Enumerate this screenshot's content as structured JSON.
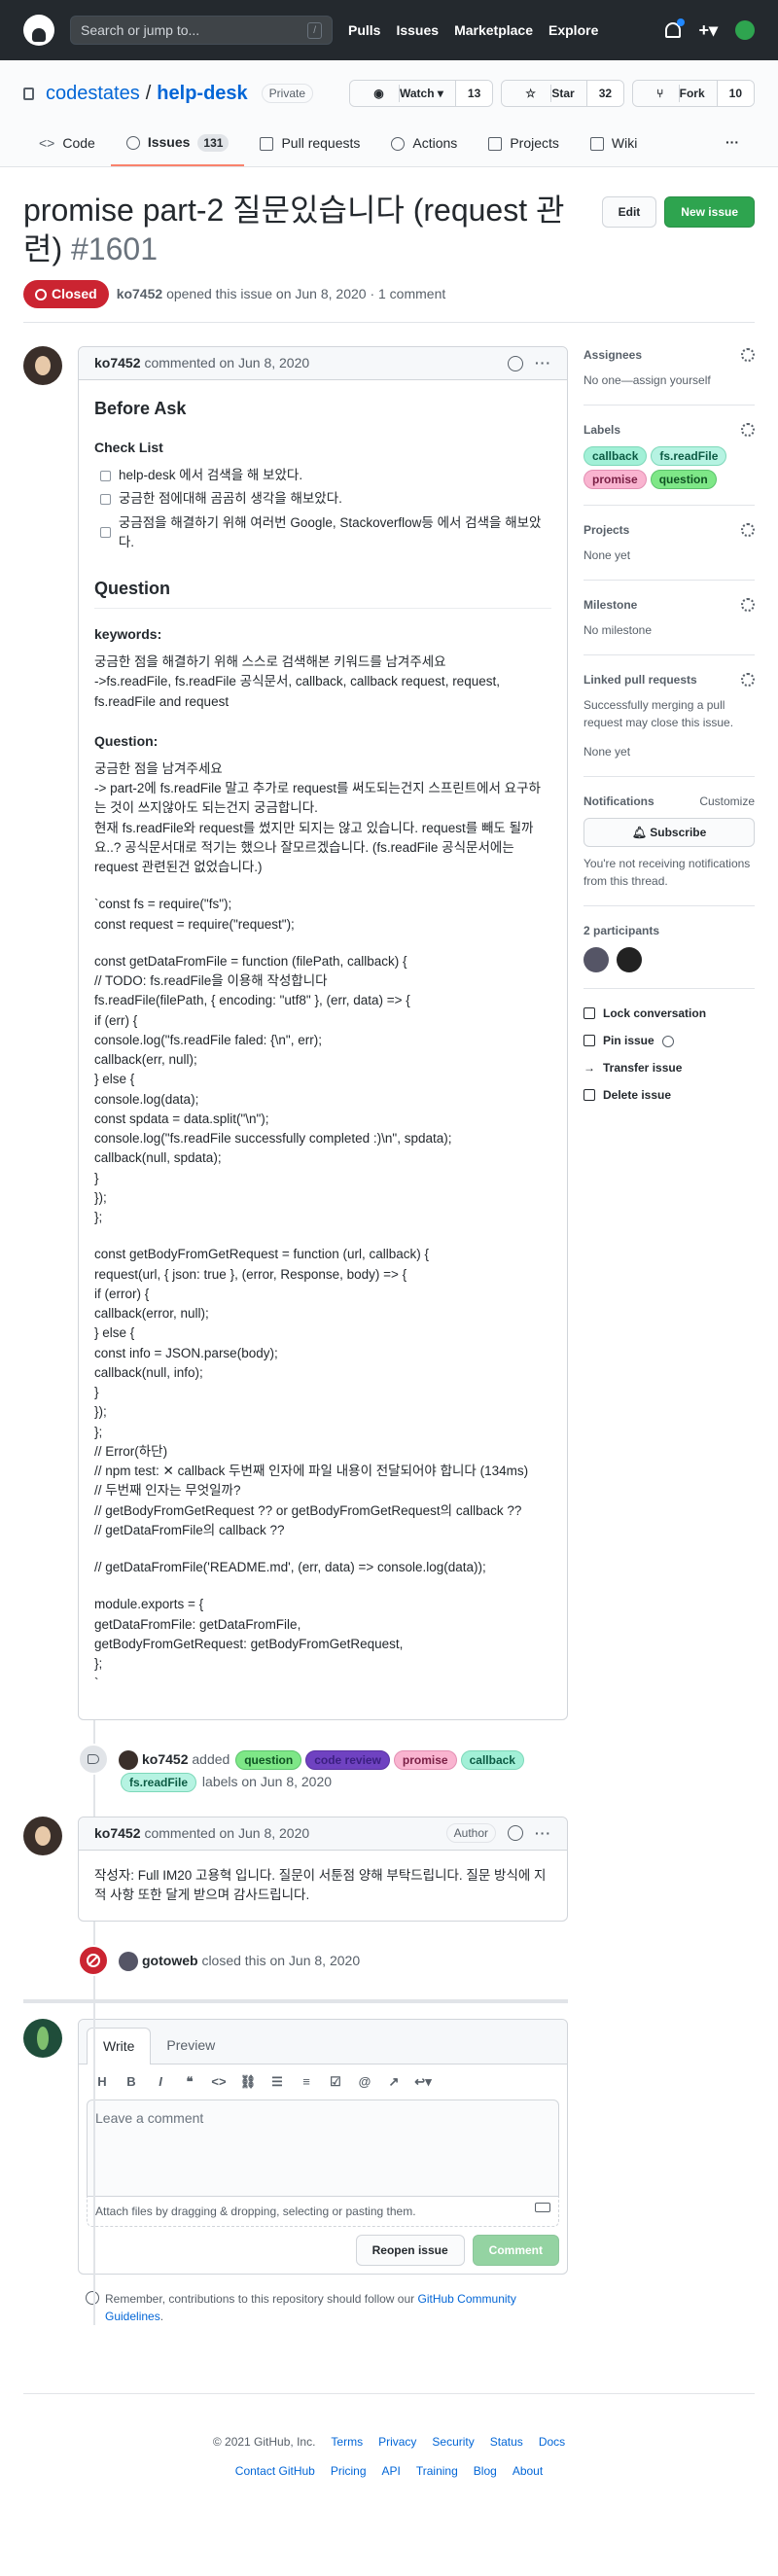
{
  "header": {
    "search_placeholder": "Search or jump to...",
    "search_kbd": "/",
    "nav": [
      "Pulls",
      "Issues",
      "Marketplace",
      "Explore"
    ]
  },
  "repo": {
    "owner": "codestates",
    "separator": "/",
    "name": "help-desk",
    "visibility": "Private",
    "watch_label": "Watch",
    "watch_count": "13",
    "star_label": "Star",
    "star_count": "32",
    "fork_label": "Fork",
    "fork_count": "10"
  },
  "tabs": [
    {
      "label": "Code"
    },
    {
      "label": "Issues",
      "count": "131"
    },
    {
      "label": "Pull requests"
    },
    {
      "label": "Actions"
    },
    {
      "label": "Projects"
    },
    {
      "label": "Wiki"
    }
  ],
  "tabs_more": "···",
  "issue": {
    "title": "promise part-2 질문있습니다 (request 관련)",
    "number": "#1601",
    "edit_label": "Edit",
    "new_issue_label": "New issue",
    "state": "Closed",
    "author": "ko7452",
    "meta": "opened this issue on Jun 8, 2020 · 1 comment"
  },
  "comment1": {
    "author": "ko7452",
    "meta": "commented on Jun 8, 2020",
    "h_before": "Before Ask",
    "h_checklist": "Check List",
    "tasks": [
      "help-desk 에서 검색을 해 보았다.",
      "궁금한 점에대해 곰곰히 생각을 해보았다.",
      "궁금점을 해결하기 위해 여러번 Google, Stackoverflow등 에서 검색을 해보았다."
    ],
    "h_question": "Question",
    "h_keywords": "keywords:",
    "keywords_text": "궁금한 점을 해결하기 위해 스스로 검색해본 키워드를 남겨주세요\n->fs.readFile, fs.readFile 공식문서, callback, callback request, request, fs.readFile and request",
    "h_question2": "Question:",
    "question_text": "궁금한 점을 남겨주세요\n-> part-2에 fs.readFile 말고 추가로 request를 써도되는건지 스프린트에서 요구하는 것이 쓰지않아도 되는건지 궁금합니다.\n현재 fs.readFile와 request를 썼지만 되지는 않고 있습니다. request를 빼도 될까요..? 공식문서대로 적기는 했으나 잘모르겠습니다. (fs.readFile 공식문서에는 request 관련된건 없었습니다.)",
    "code1": "`const fs = require(\"fs\");\nconst request = require(\"request\");",
    "code2": "const getDataFromFile = function (filePath, callback) {\n// TODO: fs.readFile을 이용해 작성합니다\nfs.readFile(filePath, { encoding: \"utf8\" }, (err, data) => {\nif (err) {\nconsole.log(\"fs.readFile faled: {\\n\", err);\ncallback(err, null);\n} else {\nconsole.log(data);\nconst spdata = data.split(\"\\n\");\nconsole.log(\"fs.readFile successfully completed :)\\n\", spdata);\ncallback(null, spdata);\n}\n});\n};",
    "code3": "const getBodyFromGetRequest = function (url, callback) {\nrequest(url, { json: true }, (error, Response, body) => {\nif (error) {\ncallback(error, null);\n} else {\nconst info = JSON.parse(body);\ncallback(null, info);\n}\n});\n};\n// Error(하단)\n// npm test: ✕ callback 두번째 인자에 파일 내용이 전달되어야 합니다 (134ms)\n// 두번째 인자는 무엇일까?\n// getBodyFromGetRequest ?? or getBodyFromGetRequest의 callback ??\n// getDataFromFile의 callback ??",
    "code4": "// getDataFromFile('README.md', (err, data) => console.log(data));",
    "code5": "module.exports = {\ngetDataFromFile: getDataFromFile,\ngetBodyFromGetRequest: getBodyFromGetRequest,\n};\n`"
  },
  "label_event": {
    "actor": "ko7452",
    "verb": "added",
    "suffix": "labels on Jun 8, 2020",
    "labels": [
      "question",
      "code review",
      "promise",
      "callback",
      "fs.readFile"
    ]
  },
  "comment2": {
    "author": "ko7452",
    "meta": "commented on Jun 8, 2020",
    "author_badge": "Author",
    "text": "작성자: Full IM20 고용혁 입니다. 질문이 서툰점 양해 부탁드립니다. 질문 방식에 지적 사항 또한 달게 받으며 감사드립니다."
  },
  "close_event": {
    "actor": "gotoweb",
    "text": "closed this on Jun 8, 2020"
  },
  "new_comment": {
    "tab_write": "Write",
    "tab_preview": "Preview",
    "placeholder": "Leave a comment",
    "attach": "Attach files by dragging & dropping, selecting or pasting them.",
    "reopen": "Reopen issue",
    "submit": "Comment",
    "tip_prefix": "Remember, contributions to this repository should follow our",
    "tip_link": "GitHub Community Guidelines",
    "tip_suffix": "."
  },
  "sidebar": {
    "assignees_h": "Assignees",
    "assignees_t": "No one—assign yourself",
    "labels_h": "Labels",
    "labels": [
      "callback",
      "fs.readFile",
      "promise",
      "question"
    ],
    "projects_h": "Projects",
    "projects_t": "None yet",
    "milestone_h": "Milestone",
    "milestone_t": "No milestone",
    "linked_h": "Linked pull requests",
    "linked_t": "Successfully merging a pull request may close this issue.",
    "linked_t2": "None yet",
    "notif_h": "Notifications",
    "notif_customize": "Customize",
    "subscribe": "Subscribe",
    "notif_t": "You're not receiving notifications from this thread.",
    "participants_h": "2 participants",
    "lock": "Lock conversation",
    "pin": "Pin issue",
    "transfer": "Transfer issue",
    "delete": "Delete issue"
  },
  "footer": {
    "copyright": "© 2021 GitHub, Inc.",
    "row1": [
      "Terms",
      "Privacy",
      "Security",
      "Status",
      "Docs"
    ],
    "row2": [
      "Contact GitHub",
      "Pricing",
      "API",
      "Training",
      "Blog",
      "About"
    ]
  }
}
